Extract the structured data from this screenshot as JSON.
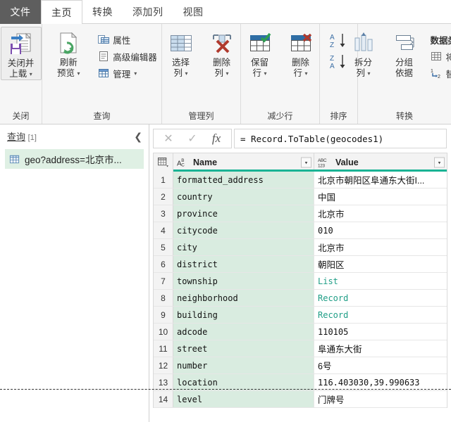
{
  "tabs": [
    {
      "label": "文件",
      "kind": "file"
    },
    {
      "label": "主页",
      "kind": "active"
    },
    {
      "label": "转换",
      "kind": "normal"
    },
    {
      "label": "添加列",
      "kind": "normal"
    },
    {
      "label": "视图",
      "kind": "normal"
    }
  ],
  "ribbon": {
    "groups": [
      {
        "label": "关闭"
      },
      {
        "label": "查询"
      },
      {
        "label": "管理列"
      },
      {
        "label": "减少行"
      },
      {
        "label": "排序"
      },
      {
        "label": "转换"
      }
    ],
    "close_and_load": {
      "line1": "关闭并",
      "line2": "上载",
      "caret": "▾"
    },
    "refresh_preview": {
      "line1": "刷新",
      "line2": "预览",
      "caret": "▾"
    },
    "properties": "属性",
    "advanced_editor": "高级编辑器",
    "manage": "管理",
    "manage_caret": "▾",
    "choose_columns": {
      "line1": "选择",
      "line2": "列",
      "caret": "▾"
    },
    "remove_columns": {
      "line1": "删除",
      "line2": "列",
      "caret": "▾"
    },
    "keep_rows": {
      "line1": "保留",
      "line2": "行",
      "caret": "▾"
    },
    "remove_rows": {
      "line1": "删除",
      "line2": "行",
      "caret": "▾"
    },
    "sort_az": "A→Z",
    "sort_za": "Z→A",
    "split_column": {
      "line1": "拆分",
      "line2": "列",
      "caret": "▾"
    },
    "group_by": {
      "line1": "分组",
      "line2": "依据"
    },
    "data_type": "数据类",
    "use_first_row": "将第",
    "replace_values": "替换"
  },
  "queries_pane": {
    "title": "查询",
    "count": "[1]",
    "collapse": "❮",
    "items": [
      {
        "label": "geo?address=北京市...",
        "selected": true
      }
    ]
  },
  "formula_bar": {
    "cancel": "✕",
    "commit": "✓",
    "fx": "fx",
    "formula": "= Record.ToTable(geocodes1)"
  },
  "grid": {
    "columns": [
      {
        "key": "name",
        "header": "Name",
        "type_icon": "ABC",
        "type_kind": "text"
      },
      {
        "key": "value",
        "header": "Value",
        "type_icon": "ABC123",
        "type_kind": "any"
      }
    ],
    "dropdown_caret": "▾",
    "rows": [
      {
        "n": "1",
        "name": "formatted_address",
        "value": "北京市朝阳区阜通东大街I...",
        "style": "text"
      },
      {
        "n": "2",
        "name": "country",
        "value": "中国",
        "style": "text"
      },
      {
        "n": "3",
        "name": "province",
        "value": "北京市",
        "style": "text"
      },
      {
        "n": "4",
        "name": "citycode",
        "value": "010",
        "style": "mono"
      },
      {
        "n": "5",
        "name": "city",
        "value": "北京市",
        "style": "text"
      },
      {
        "n": "6",
        "name": "district",
        "value": "朝阳区",
        "style": "text"
      },
      {
        "n": "7",
        "name": "township",
        "value": "List",
        "style": "link"
      },
      {
        "n": "8",
        "name": "neighborhood",
        "value": "Record",
        "style": "link"
      },
      {
        "n": "9",
        "name": "building",
        "value": "Record",
        "style": "link"
      },
      {
        "n": "10",
        "name": "adcode",
        "value": "110105",
        "style": "mono"
      },
      {
        "n": "11",
        "name": "street",
        "value": "阜通东大街",
        "style": "text"
      },
      {
        "n": "12",
        "name": "number",
        "value": "6号",
        "style": "text"
      },
      {
        "n": "13",
        "name": "location",
        "value": "116.403030,39.990633",
        "style": "mono"
      },
      {
        "n": "14",
        "name": "level",
        "value": "门牌号",
        "style": "text"
      }
    ]
  },
  "colors": {
    "accent_teal": "#19b394",
    "selection_green": "#d9ece0",
    "file_tab": "#5e5e5e",
    "ribbon_bg": "#f6f6f6"
  }
}
